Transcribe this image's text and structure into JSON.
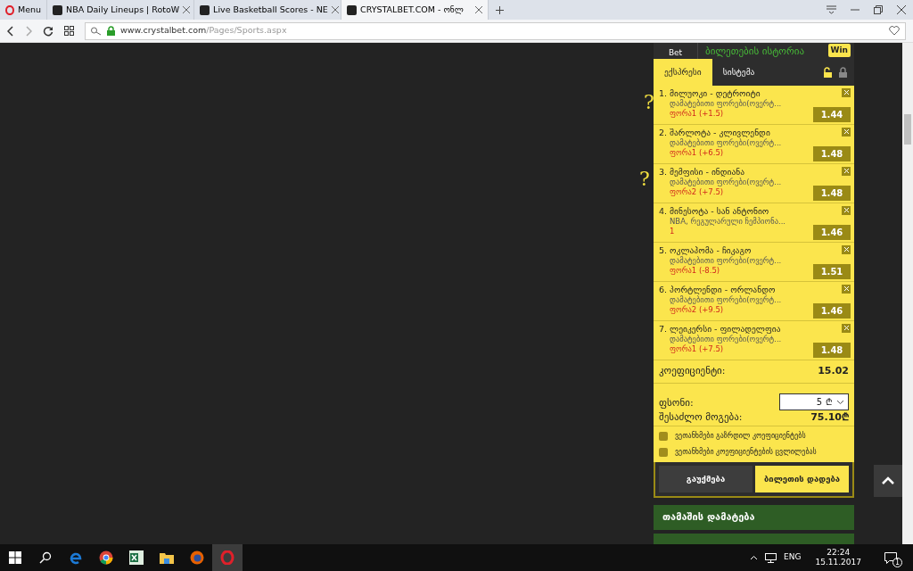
{
  "browser": {
    "tabs": [
      {
        "kind": "menu",
        "label": "Menu",
        "selected": false
      },
      {
        "kind": "page",
        "label": "NBA Daily Lineups | RotoW",
        "selected": false
      },
      {
        "kind": "page",
        "label": "Live Basketball Scores - NE",
        "selected": false
      },
      {
        "kind": "page",
        "label": "CRYSTALBET.COM - ონლ",
        "selected": true
      }
    ],
    "address": {
      "host": "www.crystalbet.com",
      "path": "/Pages/Sports.aspx"
    }
  },
  "page": {
    "marks": [
      "?",
      "?"
    ],
    "betslip": {
      "quick_bet": "Bet",
      "history": "ბილეთების ისტორია",
      "win_badge": "Win",
      "tabs": [
        {
          "label": "ექსპრესი",
          "selected": true
        },
        {
          "label": "სისტემა",
          "selected": false
        }
      ],
      "bets": [
        {
          "number": "1.",
          "match": "მილუოკი - დეტროიტი",
          "market": "დამატებითი ფორები(ოვერტ...",
          "pick": "ფორა1 (+1.5)",
          "odds": "1.44"
        },
        {
          "number": "2.",
          "match": "შარლოტა - კლივლენდი",
          "market": "დამატებითი ფორები(ოვერტ...",
          "pick": "ფორა1 (+6.5)",
          "odds": "1.48"
        },
        {
          "number": "3.",
          "match": "მემფისი - ინდიანა",
          "market": "დამატებითი ფორები(ოვერტ...",
          "pick": "ფორა2 (+7.5)",
          "odds": "1.48"
        },
        {
          "number": "4.",
          "match": "მინესოტა - სან ანტონიო",
          "market": "NBA, რეგულარული ჩემპიონა...",
          "pick": "1",
          "odds": "1.46"
        },
        {
          "number": "5.",
          "match": "ოკლაჰომა - ჩიკაგო",
          "market": "დამატებითი ფორები(ოვერტ...",
          "pick": "ფორა1 (-8.5)",
          "odds": "1.51"
        },
        {
          "number": "6.",
          "match": "პორტლენდი - ორლანდო",
          "market": "დამატებითი ფორები(ოვერტ...",
          "pick": "ფორა2 (+9.5)",
          "odds": "1.46"
        },
        {
          "number": "7.",
          "match": "ლეიკერსი - ფილადელფია",
          "market": "დამატებითი ფორები(ოვერტ...",
          "pick": "ფორა1 (+7.5)",
          "odds": "1.48"
        }
      ],
      "coefficient": {
        "label": "კოეფიციენტი:",
        "value": "15.02"
      },
      "stake": {
        "label": "ფსონი:",
        "value": "5",
        "currency": "₾"
      },
      "possible_win": {
        "label": "შესაძლო მოგება:",
        "value": "75.10₾"
      },
      "options": [
        {
          "label": "ვეთანხმები გაზრდილ კოეფიციენტებს",
          "checked": false
        },
        {
          "label": "ვეთანხმები კოეფიციენტების ცვლილებას",
          "checked": false
        }
      ],
      "buttons": [
        {
          "label": "გაუქმება",
          "kind": "secondary"
        },
        {
          "label": "ბილეთის დადება",
          "kind": "primary"
        }
      ],
      "menu": [
        "თამაშის დამატება"
      ]
    }
  },
  "taskbar": {
    "language": "ENG",
    "time": "22:24",
    "date": "15.11.2017",
    "notifications": "1"
  }
}
